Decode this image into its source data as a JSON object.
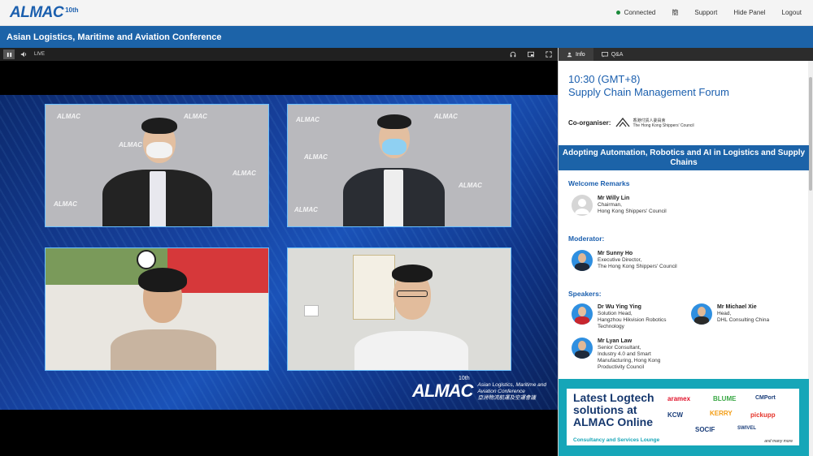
{
  "topbar": {
    "logo": "ALMAC",
    "logo_sup": "10th",
    "status": "Connected",
    "lang": "簡",
    "support": "Support",
    "hide_panel": "Hide Panel",
    "logout": "Logout"
  },
  "title": "Asian Logistics, Maritime and Aviation Conference",
  "player": {
    "live_label": "LIVE",
    "brand_logo": "ALMAC",
    "brand_sup": "10th",
    "brand_line1": "Asian Logistics, Maritime and",
    "brand_line2": "Aviation Conference",
    "brand_line3": "亞洲物流航運及空運會議",
    "backdrop_logo": "ALMAC"
  },
  "panel": {
    "tabs": [
      {
        "label": "Info"
      },
      {
        "label": "Q&A"
      }
    ],
    "time": "10:30 (GMT+8)",
    "forum": "Supply Chain Management Forum",
    "coorganiser_label": "Co-organiser:",
    "coorganiser_name_cn": "香港付貨人委員會",
    "coorganiser_name_en": "The Hong Kong Shippers' Council",
    "banner": "Adopting Automation, Robotics and AI in Logistics and Supply Chains",
    "welcome_title": "Welcome Remarks",
    "welcome": {
      "name": "Mr Willy Lin",
      "role1": "Chairman,",
      "role2": "Hong Kong Shippers' Council"
    },
    "moderator_title": "Moderator:",
    "moderator": {
      "name": "Mr Sunny Ho",
      "role1": "Executive Director,",
      "role2": "The Hong Kong Shippers' Council"
    },
    "speakers_title": "Speakers:",
    "speakers": [
      {
        "name": "Dr Wu Ying Ying",
        "role1": "Solution Head,",
        "role2": "Hangzhou Hikvision Robotics",
        "role3": "Technology"
      },
      {
        "name": "Mr Michael Xie",
        "role1": "Head,",
        "role2": "DHL Consulting China"
      },
      {
        "name": "Mr Lyan Law",
        "role1": "Senior Consultant,",
        "role2": "Industry 4.0 and Smart",
        "role3": "Manufacturing, Hong Kong",
        "role4": "Productivity Council"
      }
    ],
    "ad": {
      "line1": "Latest Logtech",
      "line2": "solutions at",
      "line3": "ALMAC Online",
      "sub": "Consultancy and Services Lounge",
      "logos": [
        "aramex",
        "BLUME",
        "CMPort",
        "KCW",
        "KERRY",
        "pickupp",
        "SOCIF",
        "SWIVEL"
      ],
      "more": "and many more"
    }
  }
}
